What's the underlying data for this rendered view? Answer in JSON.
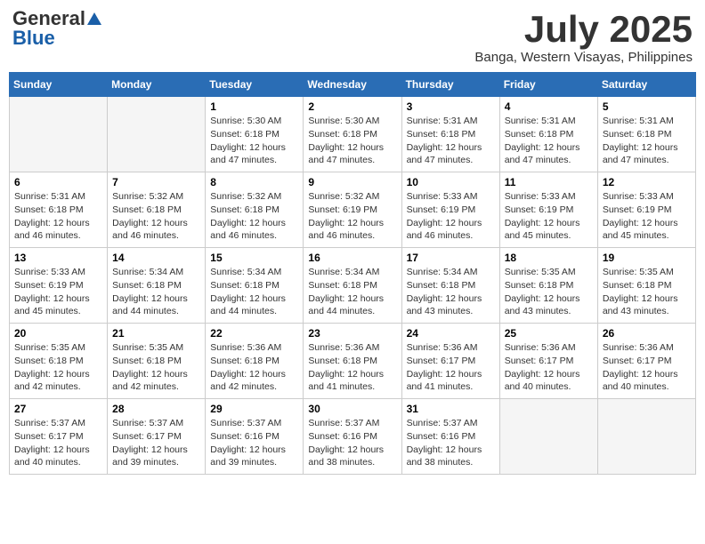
{
  "header": {
    "logo_general": "General",
    "logo_blue": "Blue",
    "month": "July 2025",
    "location": "Banga, Western Visayas, Philippines"
  },
  "days_of_week": [
    "Sunday",
    "Monday",
    "Tuesday",
    "Wednesday",
    "Thursday",
    "Friday",
    "Saturday"
  ],
  "weeks": [
    [
      {
        "day": "",
        "content": ""
      },
      {
        "day": "",
        "content": ""
      },
      {
        "day": "1",
        "content": "Sunrise: 5:30 AM\nSunset: 6:18 PM\nDaylight: 12 hours\nand 47 minutes."
      },
      {
        "day": "2",
        "content": "Sunrise: 5:30 AM\nSunset: 6:18 PM\nDaylight: 12 hours\nand 47 minutes."
      },
      {
        "day": "3",
        "content": "Sunrise: 5:31 AM\nSunset: 6:18 PM\nDaylight: 12 hours\nand 47 minutes."
      },
      {
        "day": "4",
        "content": "Sunrise: 5:31 AM\nSunset: 6:18 PM\nDaylight: 12 hours\nand 47 minutes."
      },
      {
        "day": "5",
        "content": "Sunrise: 5:31 AM\nSunset: 6:18 PM\nDaylight: 12 hours\nand 47 minutes."
      }
    ],
    [
      {
        "day": "6",
        "content": "Sunrise: 5:31 AM\nSunset: 6:18 PM\nDaylight: 12 hours\nand 46 minutes."
      },
      {
        "day": "7",
        "content": "Sunrise: 5:32 AM\nSunset: 6:18 PM\nDaylight: 12 hours\nand 46 minutes."
      },
      {
        "day": "8",
        "content": "Sunrise: 5:32 AM\nSunset: 6:18 PM\nDaylight: 12 hours\nand 46 minutes."
      },
      {
        "day": "9",
        "content": "Sunrise: 5:32 AM\nSunset: 6:19 PM\nDaylight: 12 hours\nand 46 minutes."
      },
      {
        "day": "10",
        "content": "Sunrise: 5:33 AM\nSunset: 6:19 PM\nDaylight: 12 hours\nand 46 minutes."
      },
      {
        "day": "11",
        "content": "Sunrise: 5:33 AM\nSunset: 6:19 PM\nDaylight: 12 hours\nand 45 minutes."
      },
      {
        "day": "12",
        "content": "Sunrise: 5:33 AM\nSunset: 6:19 PM\nDaylight: 12 hours\nand 45 minutes."
      }
    ],
    [
      {
        "day": "13",
        "content": "Sunrise: 5:33 AM\nSunset: 6:19 PM\nDaylight: 12 hours\nand 45 minutes."
      },
      {
        "day": "14",
        "content": "Sunrise: 5:34 AM\nSunset: 6:18 PM\nDaylight: 12 hours\nand 44 minutes."
      },
      {
        "day": "15",
        "content": "Sunrise: 5:34 AM\nSunset: 6:18 PM\nDaylight: 12 hours\nand 44 minutes."
      },
      {
        "day": "16",
        "content": "Sunrise: 5:34 AM\nSunset: 6:18 PM\nDaylight: 12 hours\nand 44 minutes."
      },
      {
        "day": "17",
        "content": "Sunrise: 5:34 AM\nSunset: 6:18 PM\nDaylight: 12 hours\nand 43 minutes."
      },
      {
        "day": "18",
        "content": "Sunrise: 5:35 AM\nSunset: 6:18 PM\nDaylight: 12 hours\nand 43 minutes."
      },
      {
        "day": "19",
        "content": "Sunrise: 5:35 AM\nSunset: 6:18 PM\nDaylight: 12 hours\nand 43 minutes."
      }
    ],
    [
      {
        "day": "20",
        "content": "Sunrise: 5:35 AM\nSunset: 6:18 PM\nDaylight: 12 hours\nand 42 minutes."
      },
      {
        "day": "21",
        "content": "Sunrise: 5:35 AM\nSunset: 6:18 PM\nDaylight: 12 hours\nand 42 minutes."
      },
      {
        "day": "22",
        "content": "Sunrise: 5:36 AM\nSunset: 6:18 PM\nDaylight: 12 hours\nand 42 minutes."
      },
      {
        "day": "23",
        "content": "Sunrise: 5:36 AM\nSunset: 6:18 PM\nDaylight: 12 hours\nand 41 minutes."
      },
      {
        "day": "24",
        "content": "Sunrise: 5:36 AM\nSunset: 6:17 PM\nDaylight: 12 hours\nand 41 minutes."
      },
      {
        "day": "25",
        "content": "Sunrise: 5:36 AM\nSunset: 6:17 PM\nDaylight: 12 hours\nand 40 minutes."
      },
      {
        "day": "26",
        "content": "Sunrise: 5:36 AM\nSunset: 6:17 PM\nDaylight: 12 hours\nand 40 minutes."
      }
    ],
    [
      {
        "day": "27",
        "content": "Sunrise: 5:37 AM\nSunset: 6:17 PM\nDaylight: 12 hours\nand 40 minutes."
      },
      {
        "day": "28",
        "content": "Sunrise: 5:37 AM\nSunset: 6:17 PM\nDaylight: 12 hours\nand 39 minutes."
      },
      {
        "day": "29",
        "content": "Sunrise: 5:37 AM\nSunset: 6:16 PM\nDaylight: 12 hours\nand 39 minutes."
      },
      {
        "day": "30",
        "content": "Sunrise: 5:37 AM\nSunset: 6:16 PM\nDaylight: 12 hours\nand 38 minutes."
      },
      {
        "day": "31",
        "content": "Sunrise: 5:37 AM\nSunset: 6:16 PM\nDaylight: 12 hours\nand 38 minutes."
      },
      {
        "day": "",
        "content": ""
      },
      {
        "day": "",
        "content": ""
      }
    ]
  ]
}
